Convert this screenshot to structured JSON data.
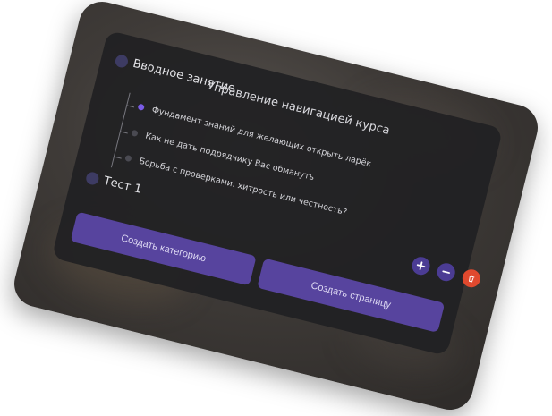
{
  "panel": {
    "title": "Управление навигацией курса"
  },
  "tree": [
    {
      "type": "category",
      "label": "Вводное занятие",
      "pages": [
        {
          "label": "Фундамент знаний для желающих открыть ларёк",
          "active": true
        },
        {
          "label": "Как не дать подрядчику Вас обмануть",
          "active": false
        },
        {
          "label": "Борьба с проверками: хитрость или честность?",
          "active": false
        }
      ]
    },
    {
      "type": "category",
      "label": "Тест 1",
      "pages": []
    }
  ],
  "buttons": {
    "create_category": "Создать категорию",
    "create_page": "Создать страницу"
  },
  "icons": {
    "add": "plus-icon",
    "edit": "minus-icon",
    "delete": "trash-icon"
  },
  "colors": {
    "accent": "#57449e",
    "active_dot": "#7a5ce6",
    "delete": "#e0492e",
    "panel_bg": "#212123"
  }
}
